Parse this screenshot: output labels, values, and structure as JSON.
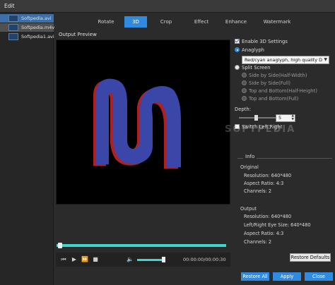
{
  "window": {
    "title": "Edit"
  },
  "files": [
    {
      "name": "Softpedia.avi"
    },
    {
      "name": "Softpedia.m4v"
    },
    {
      "name": "Softpedia1.avi"
    }
  ],
  "tabs": [
    {
      "label": "Rotate"
    },
    {
      "label": "3D"
    },
    {
      "label": "Crop"
    },
    {
      "label": "Effect"
    },
    {
      "label": "Enhance"
    },
    {
      "label": "Watermark"
    }
  ],
  "preview": {
    "label": "Output Preview"
  },
  "player": {
    "timecode": "00:00:00/00:00:30",
    "progress_fraction": 0.0
  },
  "settings3d": {
    "enable_label": "Enable 3D Settings",
    "anaglyph_label": "Anaglyph",
    "anaglyph_option": "Red/cyan anaglyph, high quality D",
    "split_label": "Split Screen",
    "split_options": [
      "Side by Side(Half-Width)",
      "Side by Side(Full)",
      "Top and Bottom(Half-Height)",
      "Top and Bottom(Full)"
    ],
    "depth_label": "Depth:",
    "depth_value": "5",
    "switch_label": "Switch Left Right"
  },
  "watermark_text": "SOFTPEDIA",
  "info": {
    "title": "Info",
    "original_label": "Original",
    "original": [
      "Resolution: 640*480",
      "Aspect Ratio: 4:3",
      "Channels: 2"
    ],
    "output_label": "Output",
    "output": [
      "Resolution: 640*480",
      "Left/Right Eye Size: 640*480",
      "Aspect Ratio: 4:3",
      "Channels: 2"
    ]
  },
  "buttons": {
    "restore_defaults": "Restore Defaults",
    "restore_all": "Restore All",
    "apply": "Apply",
    "close": "Close"
  },
  "colors": {
    "accent": "#2f8be0",
    "progress": "#3dd6d0",
    "shape_blue": "#3a47a8",
    "shape_red": "#b02020"
  }
}
